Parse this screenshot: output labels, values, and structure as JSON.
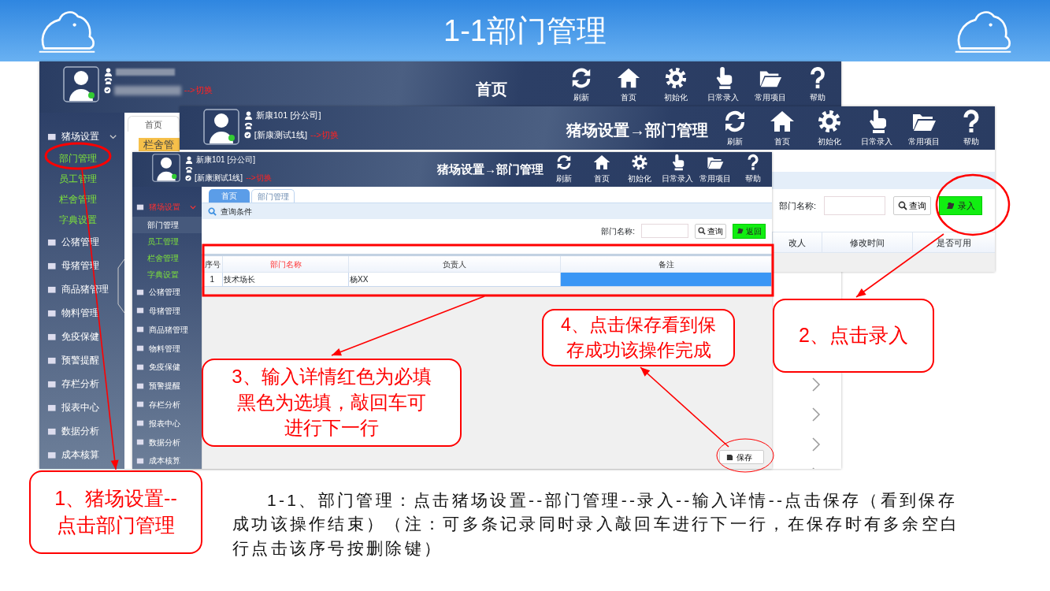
{
  "slide": {
    "title": "1-1部门管理"
  },
  "back_window": {
    "switch_link": "-->切换",
    "page_title": "首页",
    "toolbar": [
      "刷新",
      "首页",
      "初始化",
      "日常录入",
      "常用项目",
      "帮助"
    ],
    "sidebar": [
      {
        "label": "猪场设置",
        "active": false,
        "expanded": true,
        "children": [
          {
            "label": "部门管理",
            "selected": false
          },
          {
            "label": "员工管理",
            "selected": false
          },
          {
            "label": "栏舍管理",
            "selected": false
          },
          {
            "label": "字典设置",
            "selected": false
          }
        ]
      },
      {
        "label": "公猪管理"
      },
      {
        "label": "母猪管理"
      },
      {
        "label": "商品猪管理"
      },
      {
        "label": "物料管理"
      },
      {
        "label": "免疫保健"
      },
      {
        "label": "预警提醒"
      },
      {
        "label": "存栏分析"
      },
      {
        "label": "报表中心"
      },
      {
        "label": "数据分析"
      },
      {
        "label": "成本核算"
      }
    ],
    "tab": "首页",
    "cut_label": "栏舍管"
  },
  "middle_window": {
    "user_name": "新康101 [分公司]",
    "line": "[新康测试1线]",
    "switch_link": "-->切换",
    "page_title": "猪场设置→部门管理",
    "toolbar": [
      "刷新",
      "首页",
      "初始化",
      "日常录入",
      "常用项目",
      "帮助"
    ],
    "filter_label": "部门名称:",
    "query_button": "查询",
    "add_button": "录入",
    "columns": [
      "改人",
      "修改时间",
      "是否可用"
    ]
  },
  "front_window": {
    "user_name": "新康101 [分公司]",
    "line": "[新康测试1线]",
    "switch_link": "-->切换",
    "page_title": "猪场设置→部门管理",
    "toolbar": [
      "刷新",
      "首页",
      "初始化",
      "日常录入",
      "常用项目",
      "帮助"
    ],
    "sidebar": [
      {
        "label": "猪场设置",
        "active": true,
        "expanded": true,
        "children": [
          {
            "label": "部门管理",
            "selected": true
          },
          {
            "label": "员工管理",
            "selected": false
          },
          {
            "label": "栏舍管理",
            "selected": false
          },
          {
            "label": "字典设置",
            "selected": false
          }
        ]
      },
      {
        "label": "公猪管理"
      },
      {
        "label": "母猪管理"
      },
      {
        "label": "商品猪管理"
      },
      {
        "label": "物料管理"
      },
      {
        "label": "免疫保健"
      },
      {
        "label": "预警提醒"
      },
      {
        "label": "存栏分析"
      },
      {
        "label": "报表中心"
      },
      {
        "label": "数据分析"
      },
      {
        "label": "成本核算"
      }
    ],
    "tabs": [
      {
        "label": "首页",
        "selected": true
      },
      {
        "label": "部门管理",
        "selected": false
      }
    ],
    "query_section": "查询条件",
    "filter_label": "部门名称:",
    "query_button": "查询",
    "back_button": "返回",
    "columns": [
      {
        "label": "序号",
        "required": false
      },
      {
        "label": "部门名称",
        "required": true
      },
      {
        "label": "负责人",
        "required": false
      },
      {
        "label": "备注",
        "required": false
      }
    ],
    "rows": [
      {
        "index": "1",
        "name": "技术场长",
        "owner": "杨XX",
        "note_selected": true
      }
    ],
    "save_button": "保存"
  },
  "callouts": [
    "1、猪场设置--点击部门管理",
    "2、点击录入",
    "3、输入详情红色为必填黑色为选填，敲回车可进行下一行",
    "4、点击保存看到保存成功该操作完成"
  ],
  "description": "1-1、部门管理：点击猪场设置--部门管理--录入--输入详情--点击保存（看到保存成功该操作结束）（注：可多条记录同时录入敲回车进行下一行，在保存时有多余空白行点击该序号按删除键）"
}
